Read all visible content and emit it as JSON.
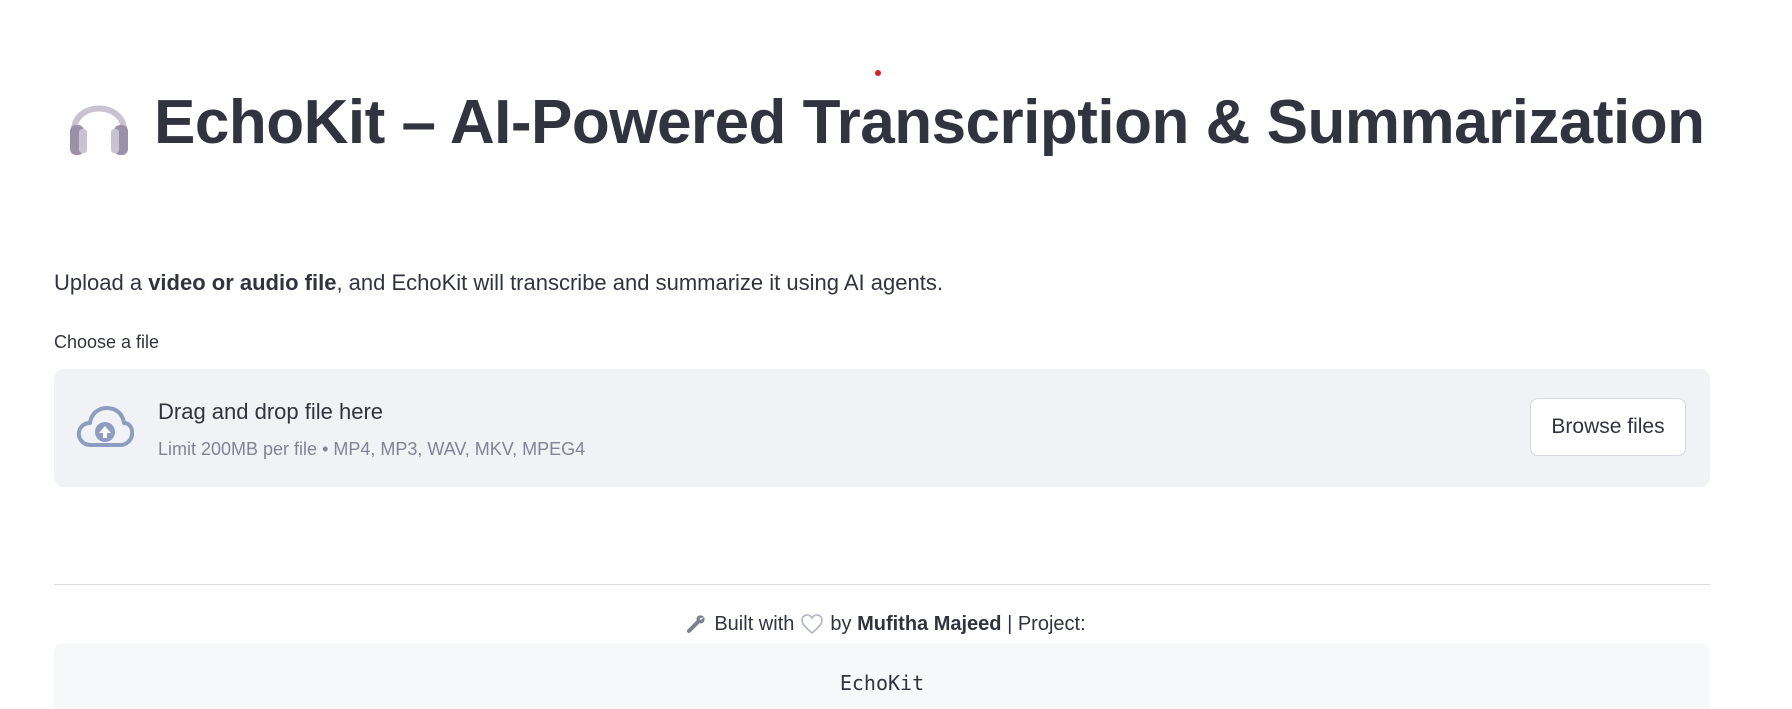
{
  "header": {
    "icon": "headphones-icon",
    "title": "EchoKit – AI-Powered Transcription & Summarization"
  },
  "intro": {
    "prefix": "Upload a ",
    "bold": "video or audio file",
    "suffix": ", and EchoKit will transcribe and summarize it using AI agents."
  },
  "uploader": {
    "label": "Choose a file",
    "icon": "cloud-upload-icon",
    "drop_text": "Drag and drop file here",
    "limit_text": "Limit 200MB per file • MP4, MP3, WAV, MKV, MPEG4",
    "browse_label": "Browse files"
  },
  "footer": {
    "wrench_icon": "wrench-icon",
    "built_with": "Built with",
    "heart_icon": "heart-icon",
    "by": "by",
    "author": "Mufitha Majeed",
    "project_label": "| Project:",
    "project_code": "EchoKit"
  },
  "colors": {
    "text": "#31333f",
    "muted": "#808495",
    "dropzone_bg": "#f0f2f6",
    "code_bg": "#f7f8fa",
    "status_dot": "#d62222"
  }
}
